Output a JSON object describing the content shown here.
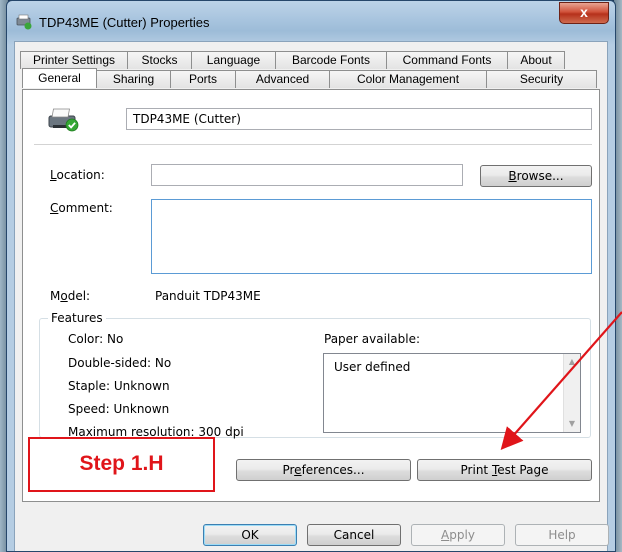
{
  "window": {
    "title": "TDP43ME (Cutter) Properties",
    "close_label": "x"
  },
  "tabs": {
    "row1": [
      "Printer Settings",
      "Stocks",
      "Language",
      "Barcode Fonts",
      "Command Fonts",
      "About"
    ],
    "row2": [
      "General",
      "Sharing",
      "Ports",
      "Advanced",
      "Color Management",
      "Security"
    ],
    "selected": "General"
  },
  "general": {
    "printer_name": "TDP43ME (Cutter)",
    "location_label_u": "L",
    "location_label_rest": "ocation:",
    "location_value": "",
    "browse_u": "B",
    "browse_rest": "rowse...",
    "comment_label_u": "C",
    "comment_label_rest": "omment:",
    "comment_value": "",
    "model_label_a": "M",
    "model_label_u": "o",
    "model_label_rest": "del:",
    "model_value": "Panduit TDP43ME"
  },
  "features": {
    "legend": "Features",
    "color": "Color: No",
    "double_sided": "Double-sided: No",
    "staple": "Staple: Unknown",
    "speed": "Speed: Unknown",
    "max_resolution": "Maximum resolution: 300 dpi",
    "paper_label": "Paper available:",
    "paper_items": [
      "User defined"
    ]
  },
  "actions": {
    "preferences_a": "Pr",
    "preferences_u": "e",
    "preferences_rest": "ferences...",
    "print_test_a": "Print ",
    "print_test_u": "T",
    "print_test_rest": "est Page"
  },
  "dialog_buttons": {
    "ok": "OK",
    "cancel": "Cancel",
    "apply_u": "A",
    "apply_rest": "pply",
    "help": "Help"
  },
  "annotation": {
    "step_label": "Step 1.H",
    "color": "#e0151a"
  }
}
